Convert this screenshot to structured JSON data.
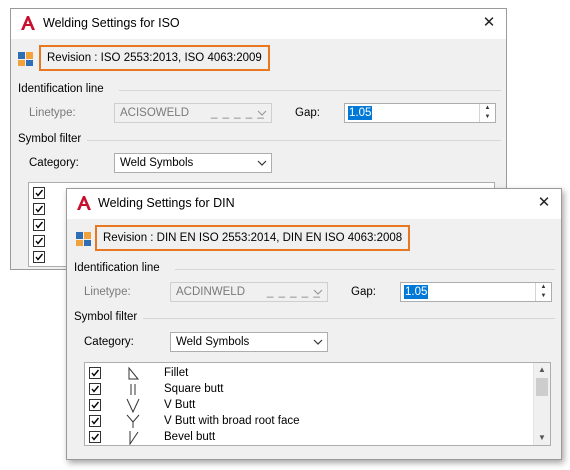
{
  "iso_dialog": {
    "title": "Welding Settings for ISO",
    "close_glyph": "✕",
    "revision": "Revision : ISO 2553:2013, ISO 4063:2009",
    "identification_section": "Identification line",
    "linetype_label": "Linetype:",
    "linetype_value": "ACISOWELD",
    "linetype_pattern": "_ _ _ _ _",
    "gap_label": "Gap:",
    "gap_value": "1.05",
    "symbol_filter_section": "Symbol filter",
    "category_label": "Category:",
    "category_value": "Weld Symbols"
  },
  "din_dialog": {
    "title": "Welding Settings for DIN",
    "close_glyph": "✕",
    "revision": "Revision : DIN EN ISO 2553:2014, DIN EN ISO 4063:2008",
    "identification_section": "Identification line",
    "linetype_label": "Linetype:",
    "linetype_value": "ACDINWELD",
    "linetype_pattern": "_ _ _ _ _",
    "gap_label": "Gap:",
    "gap_value": "1.05",
    "symbol_filter_section": "Symbol filter",
    "category_label": "Category:",
    "category_value": "Weld Symbols",
    "symbols": [
      {
        "label": "Fillet",
        "icon": "fillet-weld-icon",
        "checked": true
      },
      {
        "label": "Square butt",
        "icon": "square-butt-weld-icon",
        "checked": true
      },
      {
        "label": "V Butt",
        "icon": "v-butt-weld-icon",
        "checked": true
      },
      {
        "label": "V Butt with broad root face",
        "icon": "y-butt-weld-icon",
        "checked": true
      },
      {
        "label": "Bevel butt",
        "icon": "bevel-butt-weld-icon",
        "checked": true
      }
    ]
  },
  "colors": {
    "highlight_border": "#e87722",
    "autocad_red": "#c8102e",
    "selection_blue": "#0078d7"
  }
}
